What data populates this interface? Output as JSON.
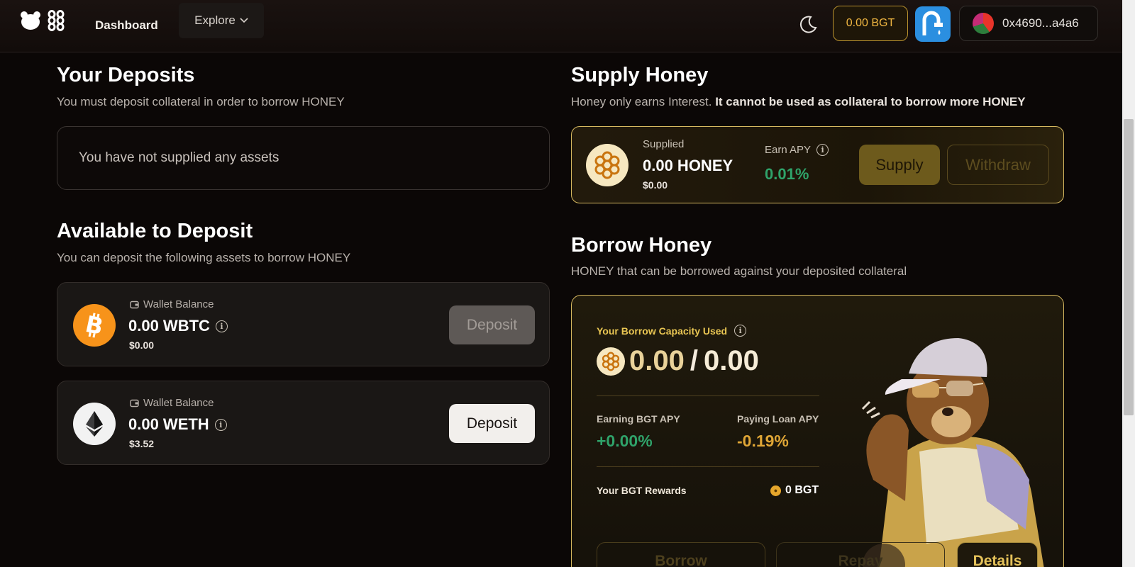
{
  "nav": {
    "dashboard": "Dashboard",
    "explore": "Explore",
    "bgt_balance": "0.00 BGT",
    "wallet_address": "0x4690...a4a6"
  },
  "deposits": {
    "title": "Your Deposits",
    "subtitle": "You must deposit collateral in order to borrow HONEY",
    "empty_text": "You have not supplied any assets"
  },
  "available": {
    "title": "Available to Deposit",
    "subtitle": "You can deposit the following assets to borrow HONEY",
    "assets": [
      {
        "label": "Wallet Balance",
        "amount": "0.00 WBTC",
        "usd": "$0.00",
        "button": "Deposit",
        "enabled": false,
        "icon": "bitcoin-icon",
        "color": "#f7931a"
      },
      {
        "label": "Wallet Balance",
        "amount": "0.00 WETH",
        "usd": "$3.52",
        "button": "Deposit",
        "enabled": true,
        "icon": "ethereum-icon",
        "color": "#f2f2f2"
      }
    ]
  },
  "supply": {
    "title": "Supply Honey",
    "subtitle_plain": "Honey only earns Interest.",
    "subtitle_bold": "It cannot be used as collateral to borrow more HONEY",
    "supplied_label": "Supplied",
    "supplied_amount": "0.00 HONEY",
    "supplied_usd": "$0.00",
    "apy_label": "Earn APY",
    "apy_value": "0.01%",
    "supply_button": "Supply",
    "withdraw_button": "Withdraw"
  },
  "borrow": {
    "title": "Borrow Honey",
    "subtitle": "HONEY that can be borrowed against your deposited collateral",
    "capacity_label": "Your Borrow Capacity Used",
    "capacity_used": "0.00",
    "capacity_sep": "/",
    "capacity_total": "0.00",
    "earning_label": "Earning BGT APY",
    "earning_value": "+0.00%",
    "paying_label": "Paying Loan APY",
    "paying_value": "-0.19%",
    "rewards_label": "Your BGT Rewards",
    "rewards_value": "0 BGT",
    "borrow_button": "Borrow",
    "repay_button": "Repay",
    "details_button": "Details"
  },
  "colors": {
    "accent_gold": "#d6b860",
    "positive_green": "#2fa36a",
    "negative_orange": "#e0a636",
    "bgt_gold": "#f2b842"
  }
}
